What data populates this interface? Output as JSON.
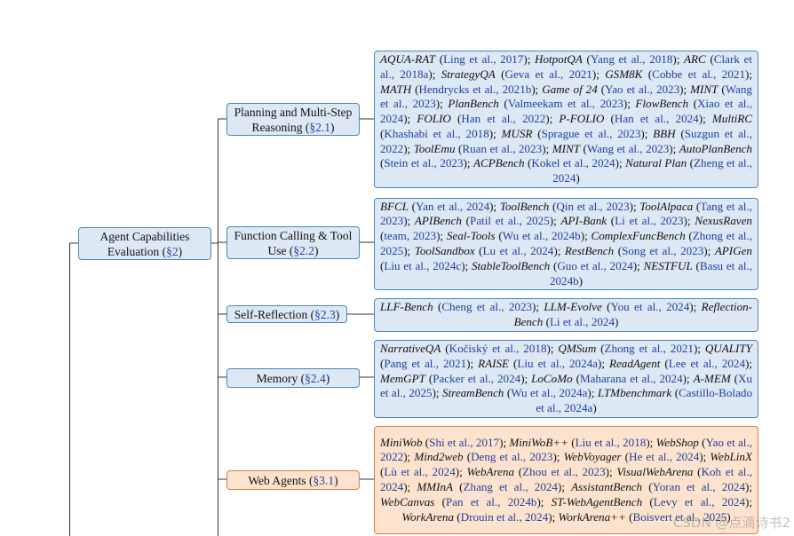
{
  "root": {
    "label": "Agent Capabilities Evaluation (",
    "ref": "§2",
    "suffix": ")"
  },
  "categories": [
    {
      "id": "planning",
      "label": "Planning and Multi-Step Reasoning (",
      "ref": "§2.1",
      "suffix": ")",
      "color": "blue",
      "entries": [
        [
          "AQUA-RAT",
          "Ling et al., 2017"
        ],
        [
          "HotpotQA",
          "Yang et al., 2018"
        ],
        [
          "ARC",
          "Clark et al., 2018a"
        ],
        [
          "StrategyQA",
          "Geva et al., 2021"
        ],
        [
          "GSM8K",
          "Cobbe et al., 2021"
        ],
        [
          "MATH",
          "Hendrycks et al., 2021b"
        ],
        [
          "Game of 24",
          "Yao et al., 2023"
        ],
        [
          "MINT",
          "Wang et al., 2023"
        ],
        [
          "PlanBench",
          "Valmeekam et al., 2023"
        ],
        [
          "FlowBench",
          "Xiao et al., 2024"
        ],
        [
          "FOLIO",
          "Han et al., 2022"
        ],
        [
          "P-FOLIO",
          "Han et al., 2024"
        ],
        [
          "MultiRC",
          "Khashabi et al., 2018"
        ],
        [
          "MUSR",
          "Sprague et al., 2023"
        ],
        [
          "BBH",
          "Suzgun et al., 2022"
        ],
        [
          "ToolEmu",
          "Ruan et al., 2023"
        ],
        [
          "MINT",
          "Wang et al., 2023"
        ],
        [
          "AutoPlanBench",
          "Stein et al., 2023"
        ],
        [
          "ACPBench",
          "Kokel et al., 2024"
        ],
        [
          "Natural Plan",
          "Zheng et al., 2024"
        ]
      ]
    },
    {
      "id": "function",
      "label": "Function Calling & Tool Use (",
      "ref": "§2.2",
      "suffix": ")",
      "color": "blue",
      "entries": [
        [
          "BFCL",
          "Yan et al., 2024"
        ],
        [
          "ToolBench",
          "Qin et al., 2023"
        ],
        [
          "ToolAlpaca",
          "Tang et al., 2023"
        ],
        [
          "APIBench",
          "Patil et al., 2025"
        ],
        [
          "API-Bank",
          "Li et al., 2023"
        ],
        [
          "NexusRaven",
          "team, 2023"
        ],
        [
          "Seal-Tools",
          "Wu et al., 2024b"
        ],
        [
          "ComplexFuncBench",
          "Zhong et al., 2025"
        ],
        [
          "ToolSandbox",
          "Lu et al., 2024"
        ],
        [
          "RestBench",
          "Song et al., 2023"
        ],
        [
          "APIGen",
          "Liu et al., 2024c"
        ],
        [
          "StableToolBench",
          "Guo et al., 2024"
        ],
        [
          "NESTFUL",
          "Basu et al., 2024b"
        ]
      ]
    },
    {
      "id": "reflection",
      "label": "Self-Reflection (",
      "ref": "§2.3",
      "suffix": ")",
      "color": "blue",
      "entries": [
        [
          "LLF-Bench",
          "Cheng et al., 2023"
        ],
        [
          "LLM-Evolve",
          "You et al., 2024"
        ],
        [
          "Reflection-Bench",
          "Li et al., 2024"
        ]
      ]
    },
    {
      "id": "memory",
      "label": "Memory (",
      "ref": "§2.4",
      "suffix": ")",
      "color": "blue",
      "entries": [
        [
          "NarrativeQA",
          "Kočiský et al., 2018"
        ],
        [
          "QMSum",
          "Zhong et al., 2021"
        ],
        [
          "QUALITY",
          "Pang et al., 2021"
        ],
        [
          "RAISE",
          "Liu et al., 2024a"
        ],
        [
          "ReadAgent",
          "Lee et al., 2024"
        ],
        [
          "MemGPT",
          "Packer et al., 2024"
        ],
        [
          "LoCoMo",
          "Maharana et al., 2024"
        ],
        [
          "A-MEM",
          "Xu et al., 2025"
        ],
        [
          "StreamBench",
          "Wu et al., 2024a"
        ],
        [
          "LTMbenchmark",
          "Castillo-Bolado et al., 2024a"
        ]
      ]
    },
    {
      "id": "web",
      "label": "Web Agents (",
      "ref": "§3.1",
      "suffix": ")",
      "color": "orange",
      "entries": [
        [
          "MiniWob",
          "Shi et al., 2017"
        ],
        [
          "MiniWoB++",
          "Liu et al., 2018"
        ],
        [
          "WebShop",
          "Yao et al., 2022"
        ],
        [
          "Mind2web",
          "Deng et al., 2023"
        ],
        [
          "WebVoyager",
          "He et al., 2024"
        ],
        [
          "WebLinX",
          "Lù et al., 2024"
        ],
        [
          "WebArena",
          "Zhou et al., 2023"
        ],
        [
          "VisualWebArena",
          "Koh et al., 2024"
        ],
        [
          "MMInA",
          "Zhang et al., 2024"
        ],
        [
          "AssistantBench",
          "Yoran et al., 2024"
        ],
        [
          "WebCanvas",
          "Pan et al., 2024b"
        ],
        [
          "ST-WebAgentBench",
          "Levy et al., 2024"
        ],
        [
          "WorkArena",
          "Drouin et al., 2024"
        ],
        [
          "WorkArena++",
          "Boisvert et al., 2025"
        ]
      ]
    }
  ],
  "watermark": "CSDN @点滴诗书2"
}
